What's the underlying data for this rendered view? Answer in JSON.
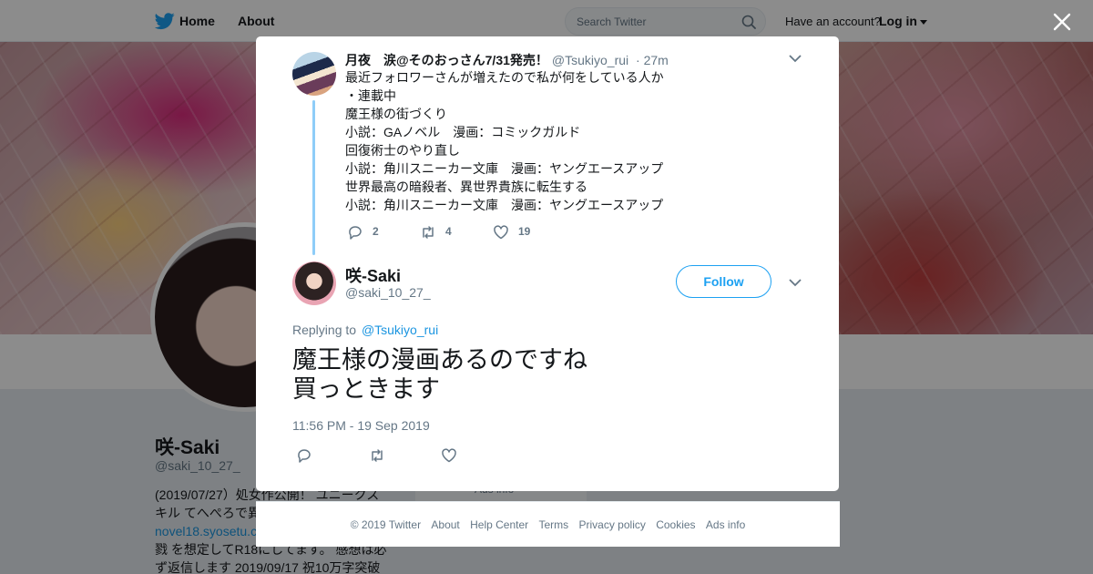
{
  "topbar": {
    "home_label": "Home",
    "about_label": "About",
    "search_placeholder": "Search Twitter",
    "have_account": "Have an account?",
    "login_label": "Log in",
    "icons": {
      "logo": "twitter-bird-icon",
      "search": "search-icon",
      "caret": "caret-down-icon"
    }
  },
  "profile": {
    "name": "咲-Saki",
    "handle": "@saki_10_27_",
    "bio_lines": [
      "(2019/07/27）処女作公開！ ユニークス",
      "キル てへぺろで異"
    ],
    "bio_link": "novel18.syosetu.c",
    "bio_lines_after": [
      "戮 を想定してR18にしてます。 感想は必",
      "ず返信します 2019/09/17 祝10万字突破"
    ],
    "side_card_text": "Ads info"
  },
  "modal": {
    "close_icon": "close-icon",
    "parent_tweet": {
      "name": "月夜　涙@そのおっさん7/31発売！",
      "handle": "@Tsukiyo_rui",
      "time": "· 27m",
      "lines": [
        "最近フォロワーさんが増えたので私が何をしている人か",
        "・連載中",
        "魔王様の街づくり",
        "小説：GAノベル　漫画：コミックガルド",
        "回復術士のやり直し",
        "小説：角川スニーカー文庫　漫画：ヤングエースアップ",
        "世界最高の暗殺者、異世界貴族に転生する",
        "小説：角川スニーカー文庫　漫画：ヤングエースアップ"
      ],
      "replies": "2",
      "retweets": "4",
      "likes": "19"
    },
    "main_tweet": {
      "name": "咲-Saki",
      "handle": "@saki_10_27_",
      "follow_label": "Follow",
      "replying_prefix": "Replying to",
      "replying_to": "@Tsukiyo_rui",
      "text_lines": [
        "魔王様の漫画あるのですね",
        "買っときます"
      ],
      "timestamp": "11:56 PM - 19 Sep 2019"
    }
  },
  "footer": {
    "links": [
      "© 2019 Twitter",
      "About",
      "Help Center",
      "Terms",
      "Privacy policy",
      "Cookies",
      "Ads info"
    ]
  },
  "colors": {
    "accent": "#1da1f2",
    "link": "#1b95e0",
    "thread_line": "#8ecdf8",
    "muted": "#657786",
    "text": "#14171a"
  }
}
